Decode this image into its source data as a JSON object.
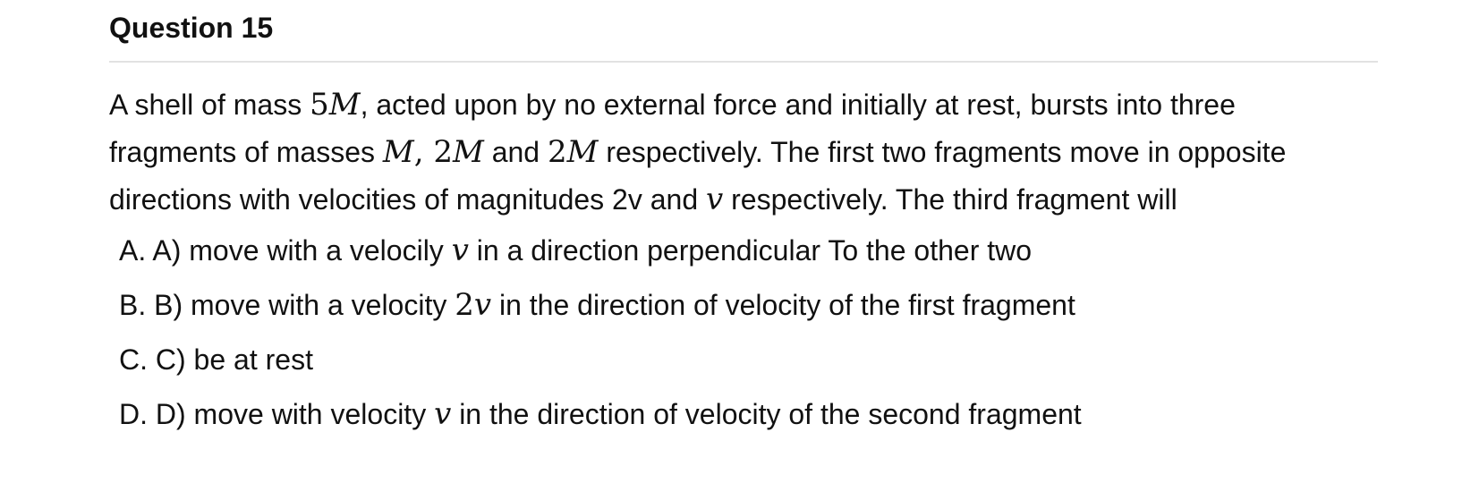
{
  "question": {
    "title": "Question 15",
    "stem": {
      "line1": [
        "A shell of mass ",
        "5",
        "M",
        ", acted upon by no external force and initially at rest, bursts into three"
      ],
      "line2": [
        "fragments of masses ",
        "M",
        ", 2",
        "M",
        " and ",
        "2",
        "M",
        " respectively. The first two fragments move in opposite"
      ],
      "line3": [
        "directions with velocities of magnitudes 2v and ",
        "v",
        " respectively. The third fragment will"
      ]
    },
    "options": [
      {
        "letter": "A.",
        "parts": [
          " A) move with a velocily ",
          "v",
          " in a direction perpendicular To the other two"
        ]
      },
      {
        "letter": "B.",
        "parts": [
          " B) move with a velocity ",
          "2",
          "v",
          " in the direction of velocity of the first fragment"
        ]
      },
      {
        "letter": "C.",
        "parts": [
          " C) be at rest"
        ]
      },
      {
        "letter": "D.",
        "parts": [
          " D) move with velocity ",
          "v",
          " in the direction of velocity of the second fragment"
        ]
      }
    ]
  }
}
